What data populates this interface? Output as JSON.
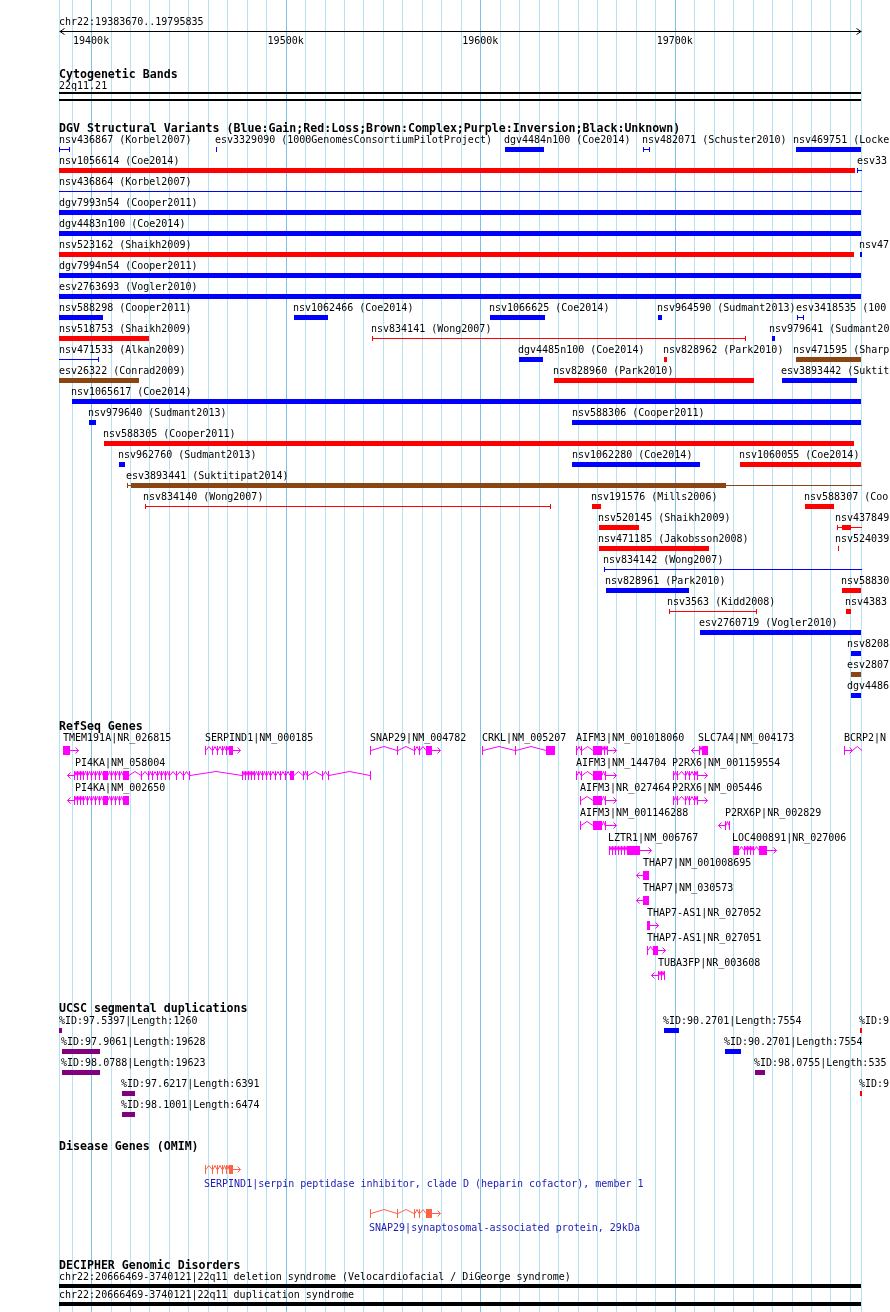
{
  "ruler": {
    "location": "chr22:19383670..19795835",
    "ticks": [
      "19400k",
      "19500k",
      "19600k",
      "19700k"
    ]
  },
  "cytogenetic_bands": {
    "title": "Cytogenetic Bands",
    "bands": [
      {
        "label": "22q11.21"
      }
    ]
  },
  "dgv_variants": {
    "title": "DGV Structural Variants (Blue:Gain;Red:Loss;Brown:Complex;Purple:Inversion;Black:Unknown)",
    "rows": [
      {
        "variants": [
          {
            "label": "nsv436867 (Korbel2007)",
            "kind": "span",
            "color": "#0000ff"
          },
          {
            "label": "esv3329090 (1000GenomesConsortiumPilotProject)",
            "kind": "bar",
            "color": "#0000ff"
          },
          {
            "label": "dgv4484n100 (Coe2014)",
            "kind": "bar",
            "color": "#0000ff"
          },
          {
            "label": "nsv482071 (Schuster2010)",
            "kind": "span",
            "color": "#0000ff"
          },
          {
            "label": "nsv469751 (Locke",
            "kind": "bar",
            "color": "#0000ff"
          }
        ]
      },
      {
        "variants": [
          {
            "label": "nsv1056614 (Coe2014)",
            "kind": "bar",
            "color": "#ff0000"
          },
          {
            "label": "esv33",
            "kind": "span",
            "color": "#0000ff"
          }
        ]
      },
      {
        "variants": [
          {
            "label": "nsv436864 (Korbel2007)",
            "kind": "span",
            "color": "#0000ff"
          }
        ]
      },
      {
        "variants": [
          {
            "label": "dgv7993n54 (Cooper2011)",
            "kind": "bar",
            "color": "#0000ff"
          }
        ]
      },
      {
        "variants": [
          {
            "label": "dgv4483n100 (Coe2014)",
            "kind": "bar",
            "color": "#0000ff"
          }
        ]
      },
      {
        "variants": [
          {
            "label": "nsv523162 (Shaikh2009)",
            "kind": "bar",
            "color": "#ff0000"
          },
          {
            "label": "nsv47",
            "kind": "bar",
            "color": "#0000ff"
          }
        ]
      },
      {
        "variants": [
          {
            "label": "dgv7994n54 (Cooper2011)",
            "kind": "bar",
            "color": "#0000ff"
          }
        ]
      },
      {
        "variants": [
          {
            "label": "esv2763693 (Vogler2010)",
            "kind": "bar",
            "color": "#0000ff"
          }
        ]
      },
      {
        "variants": [
          {
            "label": "nsv588298 (Cooper2011)",
            "kind": "bar",
            "color": "#0000ff"
          },
          {
            "label": "nsv1062466 (Coe2014)",
            "kind": "bar",
            "color": "#0000ff"
          },
          {
            "label": "nsv1066625 (Coe2014)",
            "kind": "bar",
            "color": "#0000ff"
          },
          {
            "label": "nsv964590 (Sudmant2013)",
            "kind": "bar",
            "color": "#0000ff"
          },
          {
            "label": "esv3418535 (100",
            "kind": "span",
            "color": "#0000ff"
          }
        ]
      },
      {
        "variants": [
          {
            "label": "nsv518753 (Shaikh2009)",
            "kind": "bar",
            "color": "#ff0000"
          },
          {
            "label": "nsv834141 (Wong2007)",
            "kind": "span",
            "color": "#ff0000"
          },
          {
            "label": "nsv979641 (Sudmant20",
            "kind": "bar",
            "color": "#0000ff"
          }
        ]
      },
      {
        "variants": [
          {
            "label": "nsv471533 (Alkan2009)",
            "kind": "span",
            "color": "#0000ff"
          },
          {
            "label": "dgv4485n100 (Coe2014)",
            "kind": "bar",
            "color": "#0000ff"
          },
          {
            "label": "nsv828962 (Park2010)",
            "kind": "bar",
            "color": "#ff0000"
          },
          {
            "label": "nsv471595 (Sharp",
            "kind": "bar",
            "color": "#8b4513"
          }
        ]
      },
      {
        "variants": [
          {
            "label": "esv26322 (Conrad2009)",
            "kind": "bar",
            "color": "#8b4513"
          },
          {
            "label": "nsv828960 (Park2010)",
            "kind": "bar",
            "color": "#ff0000"
          },
          {
            "label": "esv3893442 (Suktit",
            "kind": "bar",
            "color": "#0000ff"
          }
        ]
      },
      {
        "variants": [
          {
            "label": "nsv1065617 (Coe2014)",
            "kind": "bar",
            "color": "#0000ff"
          }
        ]
      },
      {
        "variants": [
          {
            "label": "nsv979640 (Sudmant2013)",
            "kind": "bar",
            "color": "#0000ff"
          },
          {
            "label": "nsv588306 (Cooper2011)",
            "kind": "bar",
            "color": "#0000ff"
          }
        ]
      },
      {
        "variants": [
          {
            "label": "nsv588305 (Cooper2011)",
            "kind": "bar",
            "color": "#ff0000"
          }
        ]
      },
      {
        "variants": [
          {
            "label": "nsv962760 (Sudmant2013)",
            "kind": "bar",
            "color": "#0000ff"
          },
          {
            "label": "nsv1062280 (Coe2014)",
            "kind": "bar",
            "color": "#0000ff"
          },
          {
            "label": "nsv1060055 (Coe2014)",
            "kind": "bar",
            "color": "#ff0000"
          }
        ]
      },
      {
        "variants": [
          {
            "label": "esv3893441 (Suktitipat2014)",
            "kind": "mixed",
            "color": "#8b4513"
          }
        ]
      },
      {
        "variants": [
          {
            "label": "nsv834140 (Wong2007)",
            "kind": "span",
            "color": "#ff0000"
          },
          {
            "label": "nsv191576 (Mills2006)",
            "kind": "bar",
            "color": "#ff0000"
          },
          {
            "label": "nsv588307 (Coo",
            "kind": "bar",
            "color": "#ff0000"
          }
        ]
      },
      {
        "variants": [
          {
            "label": "nsv520145 (Shaikh2009)",
            "kind": "bar",
            "color": "#ff0000"
          },
          {
            "label": "nsv437849",
            "kind": "mixed",
            "color": "#ff0000"
          }
        ]
      },
      {
        "variants": [
          {
            "label": "nsv471185 (Jakobsson2008)",
            "kind": "bar",
            "color": "#ff0000"
          },
          {
            "label": "nsv524039",
            "kind": "bar",
            "color": "#ff0000"
          }
        ]
      },
      {
        "variants": [
          {
            "label": "nsv834142 (Wong2007)",
            "kind": "span",
            "color": "#0000ff"
          }
        ]
      },
      {
        "variants": [
          {
            "label": "nsv828961 (Park2010)",
            "kind": "bar",
            "color": "#0000ff"
          },
          {
            "label": "nsv58830",
            "kind": "bar",
            "color": "#ff0000"
          }
        ]
      },
      {
        "variants": [
          {
            "label": "nsv3563 (Kidd2008)",
            "kind": "span",
            "color": "#ff0000"
          },
          {
            "label": "nsv4383",
            "kind": "bar",
            "color": "#ff0000"
          }
        ]
      },
      {
        "variants": [
          {
            "label": "esv2760719 (Vogler2010)",
            "kind": "bar",
            "color": "#0000ff"
          }
        ]
      },
      {
        "variants": [
          {
            "label": "nsv8208",
            "kind": "bar",
            "color": "#0000ff"
          }
        ]
      },
      {
        "variants": [
          {
            "label": "esv2807",
            "kind": "bar",
            "color": "#8b4513"
          }
        ]
      },
      {
        "variants": [
          {
            "label": "dgv4486",
            "kind": "bar",
            "color": "#0000ff"
          }
        ]
      }
    ]
  },
  "refseq_genes": {
    "title": "RefSeq Genes",
    "rows": [
      {
        "genes": [
          {
            "label": "TMEM191A|NR_026815",
            "forward": true,
            "reverse": false
          },
          {
            "label": "SERPIND1|NM_000185",
            "forward": true,
            "reverse": false
          },
          {
            "label": "SNAP29|NM_004782",
            "forward": true,
            "reverse": false
          },
          {
            "label": "CRKL|NM_005207",
            "forward": false,
            "reverse": false
          },
          {
            "label": "AIFM3|NM_001018060",
            "forward": true,
            "reverse": false
          },
          {
            "label": "SLC7A4|NM_004173",
            "forward": false,
            "reverse": true
          },
          {
            "label": "BCRP2|N",
            "forward": true,
            "reverse": false
          }
        ]
      },
      {
        "genes": [
          {
            "label": "PI4KA|NM_058004",
            "forward": false,
            "reverse": true
          },
          {
            "label": "AIFM3|NM_144704",
            "forward": true,
            "reverse": false
          },
          {
            "label": "P2RX6|NM_001159554",
            "forward": true,
            "reverse": false
          }
        ]
      },
      {
        "genes": [
          {
            "label": "PI4KA|NM_002650",
            "forward": false,
            "reverse": true
          },
          {
            "label": "AIFM3|NR_027464",
            "forward": true,
            "reverse": false
          },
          {
            "label": "P2RX6|NM_005446",
            "forward": true,
            "reverse": false
          }
        ]
      },
      {
        "genes": [
          {
            "label": "AIFM3|NM_001146288",
            "forward": true,
            "reverse": false
          },
          {
            "label": "P2RX6P|NR_002829",
            "forward": false,
            "reverse": true
          }
        ]
      },
      {
        "genes": [
          {
            "label": "LZTR1|NM_006767",
            "forward": true,
            "reverse": false
          },
          {
            "label": "LOC400891|NR_027006",
            "forward": true,
            "reverse": false
          }
        ]
      },
      {
        "genes": [
          {
            "label": "THAP7|NM_001008695",
            "forward": false,
            "reverse": true
          }
        ]
      },
      {
        "genes": [
          {
            "label": "THAP7|NM_030573",
            "forward": false,
            "reverse": true
          }
        ]
      },
      {
        "genes": [
          {
            "label": "THAP7-AS1|NR_027052",
            "forward": true,
            "reverse": false
          }
        ]
      },
      {
        "genes": [
          {
            "label": "THAP7-AS1|NR_027051",
            "forward": true,
            "reverse": false
          }
        ]
      },
      {
        "genes": [
          {
            "label": "TUBA3FP|NR_003608",
            "forward": false,
            "reverse": true
          }
        ]
      }
    ]
  },
  "segmental_duplications": {
    "title": "UCSC segmental duplications",
    "rows": [
      {
        "items": [
          {
            "label": "%ID:97.5397|Length:1260",
            "color": "#800080"
          },
          {
            "label": "%ID:90.2701|Length:7554",
            "color": "#0000ff"
          },
          {
            "label": "%ID:9",
            "color": "#ff0000"
          }
        ]
      },
      {
        "items": [
          {
            "label": "%ID:97.9061|Length:19628",
            "color": "#800080"
          },
          {
            "label": "%ID:90.2701|Length:7554",
            "color": "#0000ff"
          }
        ]
      },
      {
        "items": [
          {
            "label": "%ID:98.0788|Length:19623",
            "color": "#800080"
          },
          {
            "label": "%ID:98.0755|Length:535",
            "color": "#800080"
          }
        ]
      },
      {
        "items": [
          {
            "label": "%ID:97.6217|Length:6391",
            "color": "#800080"
          },
          {
            "label": "%ID:9",
            "color": "#ff0000"
          }
        ]
      },
      {
        "items": [
          {
            "label": "%ID:98.1001|Length:6474",
            "color": "#800080"
          }
        ]
      }
    ]
  },
  "disease_genes": {
    "title": "Disease Genes (OMIM)",
    "genes": [
      {
        "label": "SERPIND1|serpin peptidase inhibitor, clade D (heparin cofactor), member 1",
        "forward": true,
        "reverse": false
      },
      {
        "label": "SNAP29|synaptosomal-associated protein, 29kDa",
        "forward": true,
        "reverse": false
      }
    ]
  },
  "decipher_disorders": {
    "title": "DECIPHER Genomic Disorders",
    "disorders": [
      {
        "label": "chr22:20666469-3740121|22q11 deletion syndrome (Velocardiofacial / DiGeorge syndrome)"
      },
      {
        "label": "chr22:20666469-3740121|22q11 duplication syndrome"
      }
    ]
  }
}
